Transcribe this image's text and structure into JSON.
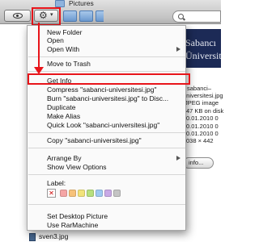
{
  "window": {
    "title": "Pictures",
    "search_placeholder": ""
  },
  "toolbar": {
    "action_menu_icon": "gear-icon",
    "quicklook_icon": "eye-icon"
  },
  "context_menu": {
    "items": [
      {
        "label": "New Folder"
      },
      {
        "label": "Open"
      },
      {
        "label": "Open With",
        "submenu": true
      },
      {
        "label": "Move to Trash"
      },
      {
        "label": "Get Info",
        "highlighted_by_annotation": true
      },
      {
        "label": "Compress \"sabanci-universitesi.jpg\""
      },
      {
        "label": "Burn \"sabanci-universitesi.jpg\" to Disc..."
      },
      {
        "label": "Duplicate"
      },
      {
        "label": "Make Alias"
      },
      {
        "label": "Quick Look \"sabanci-universitesi.jpg\""
      },
      {
        "label": "Copy \"sabanci-universitesi.jpg\""
      },
      {
        "label": "Arrange By",
        "submenu": true
      },
      {
        "label": "Show View Options"
      },
      {
        "label": "Set Desktop Picture"
      },
      {
        "label": "Use RarMachine"
      }
    ],
    "label_section": {
      "title": "Label:",
      "colors": [
        "#f5a5a5",
        "#f7c27a",
        "#f2e37a",
        "#b7e07e",
        "#9ec9f2",
        "#c8a9e6",
        "#c4c4c4"
      ]
    }
  },
  "preview": {
    "image_text_line1": "Sabancı",
    "image_text_line2": "Üniversitesi",
    "info_lines": [
      "sabanci–",
      "universitesi.jpg",
      "JPEG image",
      "47 KB on disk",
      "0.01.2010 0",
      "0.01.2010 0",
      "0.01.2010 0",
      "038 × 442"
    ],
    "more_info_label": "info..."
  },
  "file_list": {
    "visible_file": "sven3.jpg"
  },
  "annotation_color": "#e8141a"
}
